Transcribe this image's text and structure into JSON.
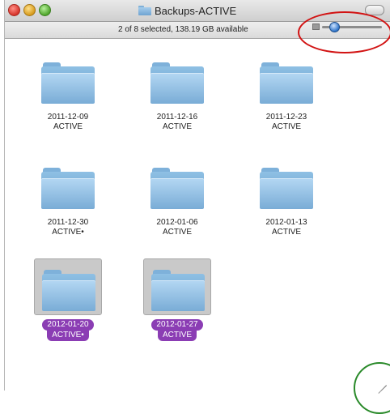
{
  "window": {
    "title": "Backups-ACTIVE",
    "status": "2 of 8 selected, 138.19 GB available"
  },
  "icons": {
    "close": "close-light-icon",
    "minimize": "minimize-light-icon",
    "zoom": "zoom-light-icon",
    "folder": "folder-icon",
    "resize": "resize-grip-icon"
  },
  "colors": {
    "selection_label": "#8b3db4",
    "annotation_red": "#d21313",
    "annotation_green": "#2a8a2a"
  },
  "slider": {
    "label": "icon-size",
    "level": 0.2
  },
  "folders": [
    {
      "date": "2011-12-09",
      "sub": "ACTIVE",
      "selected": false
    },
    {
      "date": "2011-12-16",
      "sub": "ACTIVE",
      "selected": false
    },
    {
      "date": "2011-12-23",
      "sub": "ACTIVE",
      "selected": false
    },
    {
      "date": "2011-12-30",
      "sub": "ACTIVE•",
      "selected": false
    },
    {
      "date": "2012-01-06",
      "sub": "ACTIVE",
      "selected": false
    },
    {
      "date": "2012-01-13",
      "sub": "ACTIVE",
      "selected": false
    },
    {
      "date": "2012-01-20",
      "sub": "ACTIVE•",
      "selected": true
    },
    {
      "date": "2012-01-27",
      "sub": "ACTIVE",
      "selected": true
    }
  ]
}
